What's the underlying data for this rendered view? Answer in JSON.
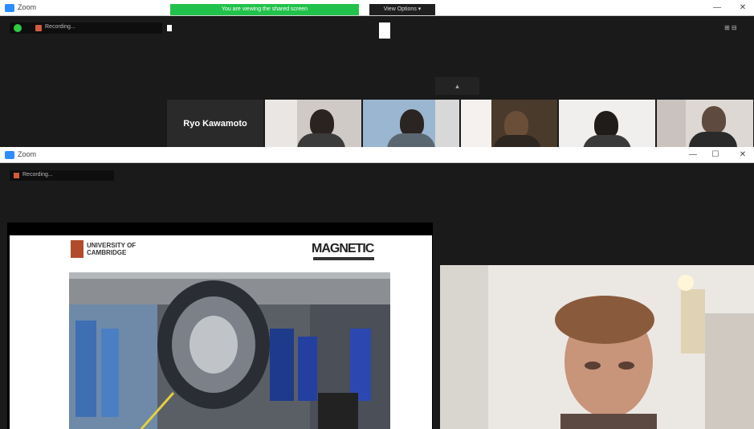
{
  "windows": [
    {
      "title": "Zoom",
      "window_controls": [
        "—",
        "☐",
        "✕"
      ],
      "banner_text": "You are viewing the shared screen",
      "view_button": "View Options ▾",
      "recording_label": "Recording...",
      "collapse_label": "▴",
      "top_right_label": "⊞ ⊟",
      "participants": [
        {
          "name": "Ryo Kawamoto"
        },
        {
          "name": ""
        },
        {
          "name": ""
        },
        {
          "name": ""
        },
        {
          "name": ""
        },
        {
          "name": ""
        }
      ]
    },
    {
      "title": "Zoom",
      "window_controls": [
        "—",
        "☐",
        "✕"
      ],
      "recording_label": "Recording...",
      "slide": {
        "university_line1": "UNIVERSITY OF",
        "university_line2": "CAMBRIDGE",
        "right_logo": "MAGNETIC"
      }
    }
  ],
  "colors": {
    "zoom_blue": "#2d8cff",
    "banner_green": "#21c24b",
    "background": "#1a1a1a"
  }
}
